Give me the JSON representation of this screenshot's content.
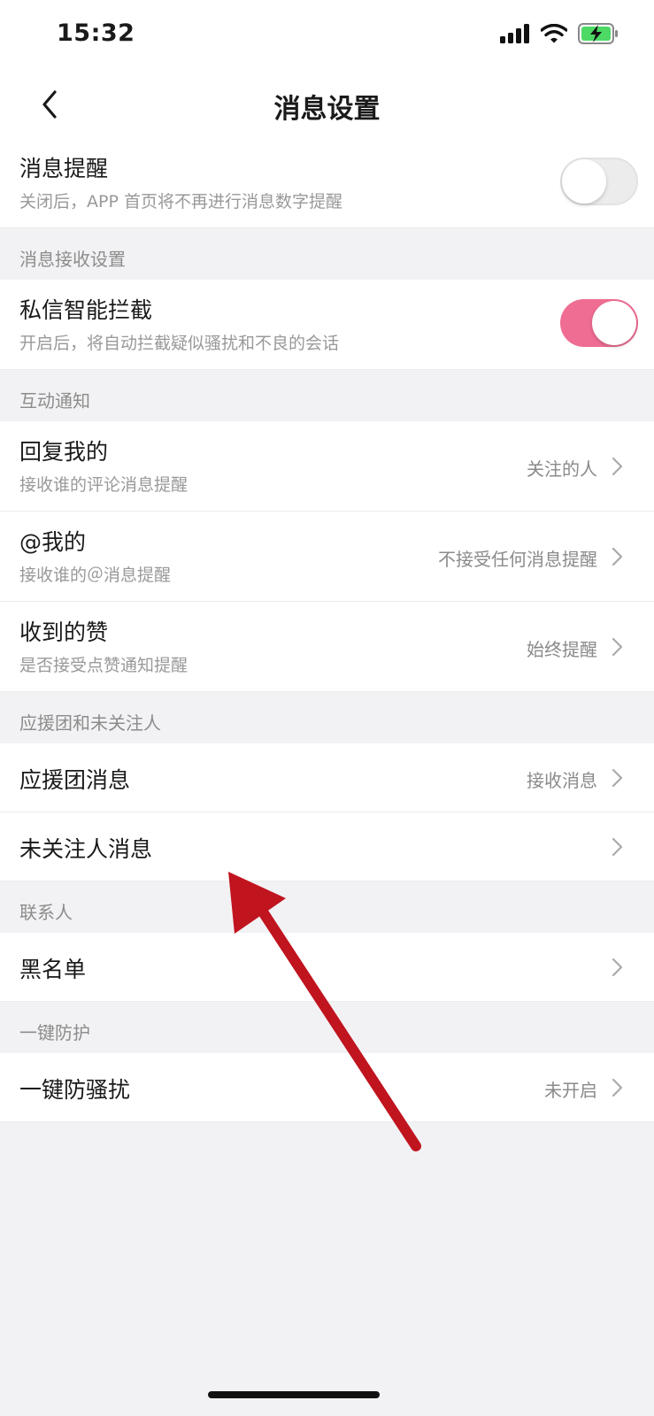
{
  "status_bar": {
    "time": "15:32"
  },
  "nav": {
    "title": "消息设置"
  },
  "rows": {
    "message_alert": {
      "title": "消息提醒",
      "subtitle": "关闭后，APP 首页将不再进行消息数字提醒",
      "toggle_on": false
    },
    "dm_filter": {
      "title": "私信智能拦截",
      "subtitle": "开启后，将自动拦截疑似骚扰和不良的会话",
      "toggle_on": true
    },
    "reply_me": {
      "title": "回复我的",
      "subtitle": "接收谁的评论消息提醒",
      "value": "关注的人"
    },
    "mention_me": {
      "title": "@我的",
      "subtitle": "接收谁的＠消息提醒",
      "value": "不接受任何消息提醒"
    },
    "likes": {
      "title": "收到的赞",
      "subtitle": "是否接受点赞通知提醒",
      "value": "始终提醒"
    },
    "fan_group": {
      "title": "应援团消息",
      "value": "接收消息"
    },
    "non_followed": {
      "title": "未关注人消息"
    },
    "blacklist": {
      "title": "黑名单"
    },
    "anti_harass": {
      "title": "一键防骚扰",
      "value": "未开启"
    }
  },
  "sections": {
    "receive": "消息接收设置",
    "interaction": "互动通知",
    "fans": "应援团和未关注人",
    "contacts": "联系人",
    "protection": "一键防护"
  },
  "colors": {
    "toggle_on": "#ef6d92",
    "arrow": "#c0141f"
  }
}
